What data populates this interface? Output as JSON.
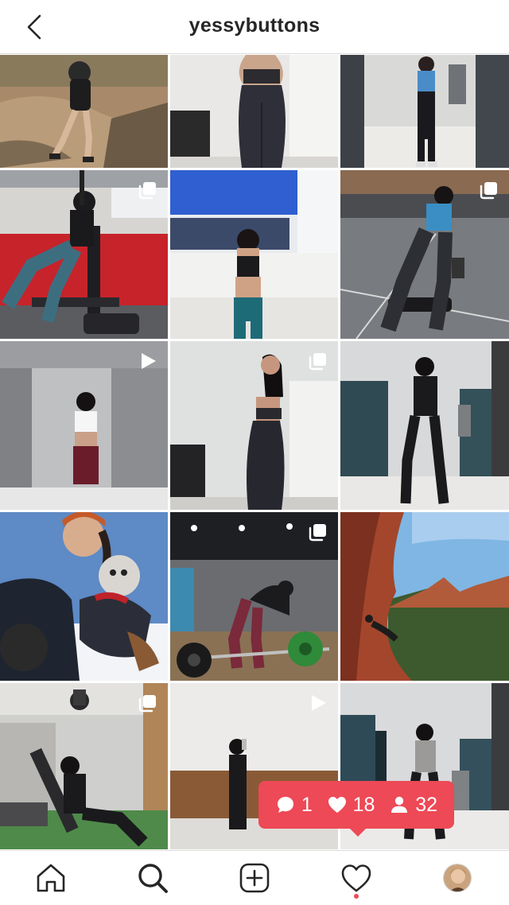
{
  "header": {
    "username": "yessybuttons",
    "back_icon": "chevron-left-icon"
  },
  "grid": {
    "posts": [
      {
        "id": "post-1",
        "scene": "hiking on rocky trail",
        "badge": null
      },
      {
        "id": "post-2",
        "scene": "back view in leggings",
        "badge": null
      },
      {
        "id": "post-3",
        "scene": "locker room mirror selfie",
        "badge": null
      },
      {
        "id": "post-4",
        "scene": "gym bench exercise",
        "badge": "carousel-icon"
      },
      {
        "id": "post-5",
        "scene": "mirror selfie by sinks",
        "badge": null
      },
      {
        "id": "post-6",
        "scene": "bench exercise at gym",
        "badge": "carousel-icon"
      },
      {
        "id": "post-7",
        "scene": "bathroom mirror selfie",
        "badge": "video-icon"
      },
      {
        "id": "post-8",
        "scene": "side pose in leggings",
        "badge": "carousel-icon"
      },
      {
        "id": "post-9",
        "scene": "hallway mirror selfie",
        "badge": null
      },
      {
        "id": "post-10",
        "scene": "snowy selfie with dog",
        "badge": null
      },
      {
        "id": "post-11",
        "scene": "deadlift at gym",
        "badge": "carousel-icon"
      },
      {
        "id": "post-12",
        "scene": "red rock canyon view",
        "badge": null
      },
      {
        "id": "post-13",
        "scene": "incline bench press",
        "badge": "carousel-icon"
      },
      {
        "id": "post-14",
        "scene": "mirror selfie at gym",
        "badge": "video-icon"
      },
      {
        "id": "post-15",
        "scene": "hallway selfie",
        "badge": null
      }
    ]
  },
  "activity_notification": {
    "comments": "1",
    "likes": "18",
    "followers": "32"
  },
  "bottom_nav": {
    "items": [
      "home-icon",
      "search-icon",
      "new-post-icon",
      "activity-heart-icon",
      "profile-avatar"
    ]
  }
}
